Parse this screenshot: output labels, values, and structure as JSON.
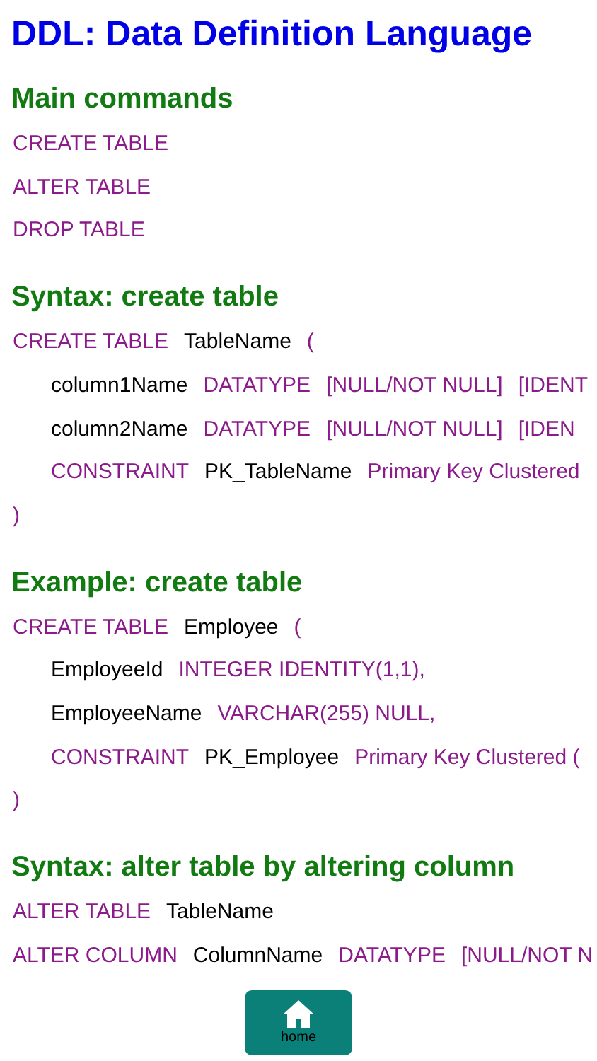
{
  "title": "DDL: Data Definition Language",
  "sections": [
    {
      "heading": "Main commands",
      "lines": [
        {
          "indent": false,
          "tokens": [
            {
              "kind": "keyword",
              "text": "CREATE TABLE"
            }
          ]
        },
        {
          "indent": false,
          "tokens": [
            {
              "kind": "keyword",
              "text": "ALTER TABLE"
            }
          ]
        },
        {
          "indent": false,
          "tokens": [
            {
              "kind": "keyword",
              "text": "DROP TABLE"
            }
          ]
        }
      ]
    },
    {
      "heading": "Syntax: create table",
      "lines": [
        {
          "indent": false,
          "tokens": [
            {
              "kind": "keyword",
              "text": "CREATE TABLE"
            },
            {
              "kind": "name",
              "text": "TableName"
            },
            {
              "kind": "keyword",
              "text": "("
            }
          ]
        },
        {
          "indent": true,
          "tokens": [
            {
              "kind": "name",
              "text": "column1Name"
            },
            {
              "kind": "keyword",
              "text": "DATATYPE"
            },
            {
              "kind": "keyword",
              "text": "[NULL/NOT NULL]"
            },
            {
              "kind": "keyword",
              "text": "[IDENT"
            }
          ]
        },
        {
          "indent": true,
          "tokens": [
            {
              "kind": "name",
              "text": "column2Name"
            },
            {
              "kind": "keyword",
              "text": "DATATYPE"
            },
            {
              "kind": "keyword",
              "text": "[NULL/NOT NULL]"
            },
            {
              "kind": "keyword",
              "text": "[IDEN"
            }
          ]
        },
        {
          "indent": true,
          "tokens": [
            {
              "kind": "keyword",
              "text": "CONSTRAINT"
            },
            {
              "kind": "name",
              "text": "PK_TableName"
            },
            {
              "kind": "keyword",
              "text": "Primary Key Clustered"
            }
          ]
        },
        {
          "indent": false,
          "tokens": [
            {
              "kind": "keyword",
              "text": ")"
            }
          ]
        }
      ]
    },
    {
      "heading": "Example: create table",
      "lines": [
        {
          "indent": false,
          "tokens": [
            {
              "kind": "keyword",
              "text": "CREATE TABLE"
            },
            {
              "kind": "name",
              "text": "Employee"
            },
            {
              "kind": "keyword",
              "text": "("
            }
          ]
        },
        {
          "indent": true,
          "tokens": [
            {
              "kind": "name",
              "text": "EmployeeId"
            },
            {
              "kind": "keyword",
              "text": "INTEGER IDENTITY(1,1),"
            }
          ]
        },
        {
          "indent": true,
          "tokens": [
            {
              "kind": "name",
              "text": "EmployeeName"
            },
            {
              "kind": "keyword",
              "text": "VARCHAR(255) NULL,"
            }
          ]
        },
        {
          "indent": true,
          "tokens": [
            {
              "kind": "keyword",
              "text": "CONSTRAINT"
            },
            {
              "kind": "name",
              "text": "PK_Employee"
            },
            {
              "kind": "keyword",
              "text": "Primary Key Clustered ("
            }
          ]
        },
        {
          "indent": false,
          "tokens": [
            {
              "kind": "keyword",
              "text": ")"
            }
          ]
        }
      ]
    },
    {
      "heading": "Syntax: alter table by altering column",
      "lines": [
        {
          "indent": false,
          "tokens": [
            {
              "kind": "keyword",
              "text": "ALTER TABLE"
            },
            {
              "kind": "name",
              "text": "TableName"
            }
          ]
        },
        {
          "indent": false,
          "tokens": [
            {
              "kind": "keyword",
              "text": "ALTER COLUMN"
            },
            {
              "kind": "name",
              "text": "ColumnName"
            },
            {
              "kind": "keyword",
              "text": "DATATYPE"
            },
            {
              "kind": "keyword",
              "text": "[NULL/NOT N"
            }
          ]
        }
      ]
    }
  ],
  "home_button": {
    "label": "home"
  }
}
